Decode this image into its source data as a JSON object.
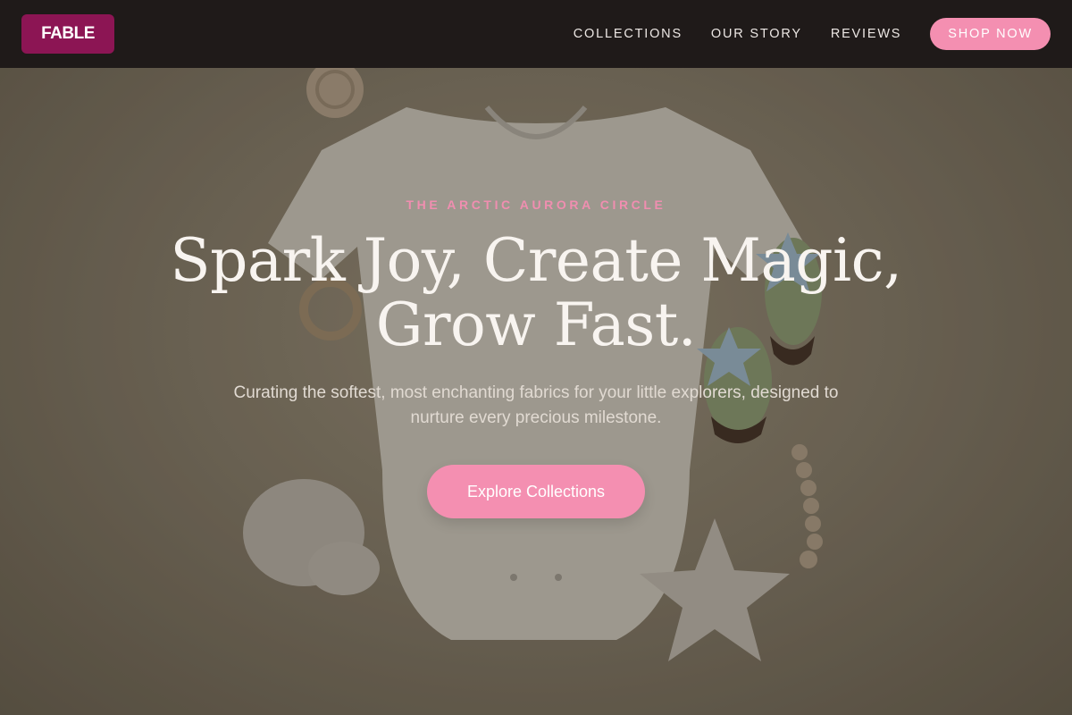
{
  "brand": {
    "logo_text": "FABLE",
    "accent_color": "#8c1554"
  },
  "nav": {
    "links": [
      {
        "label": "COLLECTIONS"
      },
      {
        "label": "OUR STORY"
      },
      {
        "label": "REVIEWS"
      }
    ],
    "cta_label": "SHOP NOW",
    "cta_color": "#f48fb1"
  },
  "hero": {
    "eyebrow": "THE ARCTIC AURORA CIRCLE",
    "headline": "Spark Joy, Create Magic, Grow Fast.",
    "subhead": "Curating the softest, most enchanting fabrics for your little explorers, designed to nurture every precious milestone.",
    "cta_label": "Explore Collections",
    "background_image": "baby-onesie-flatlay"
  }
}
